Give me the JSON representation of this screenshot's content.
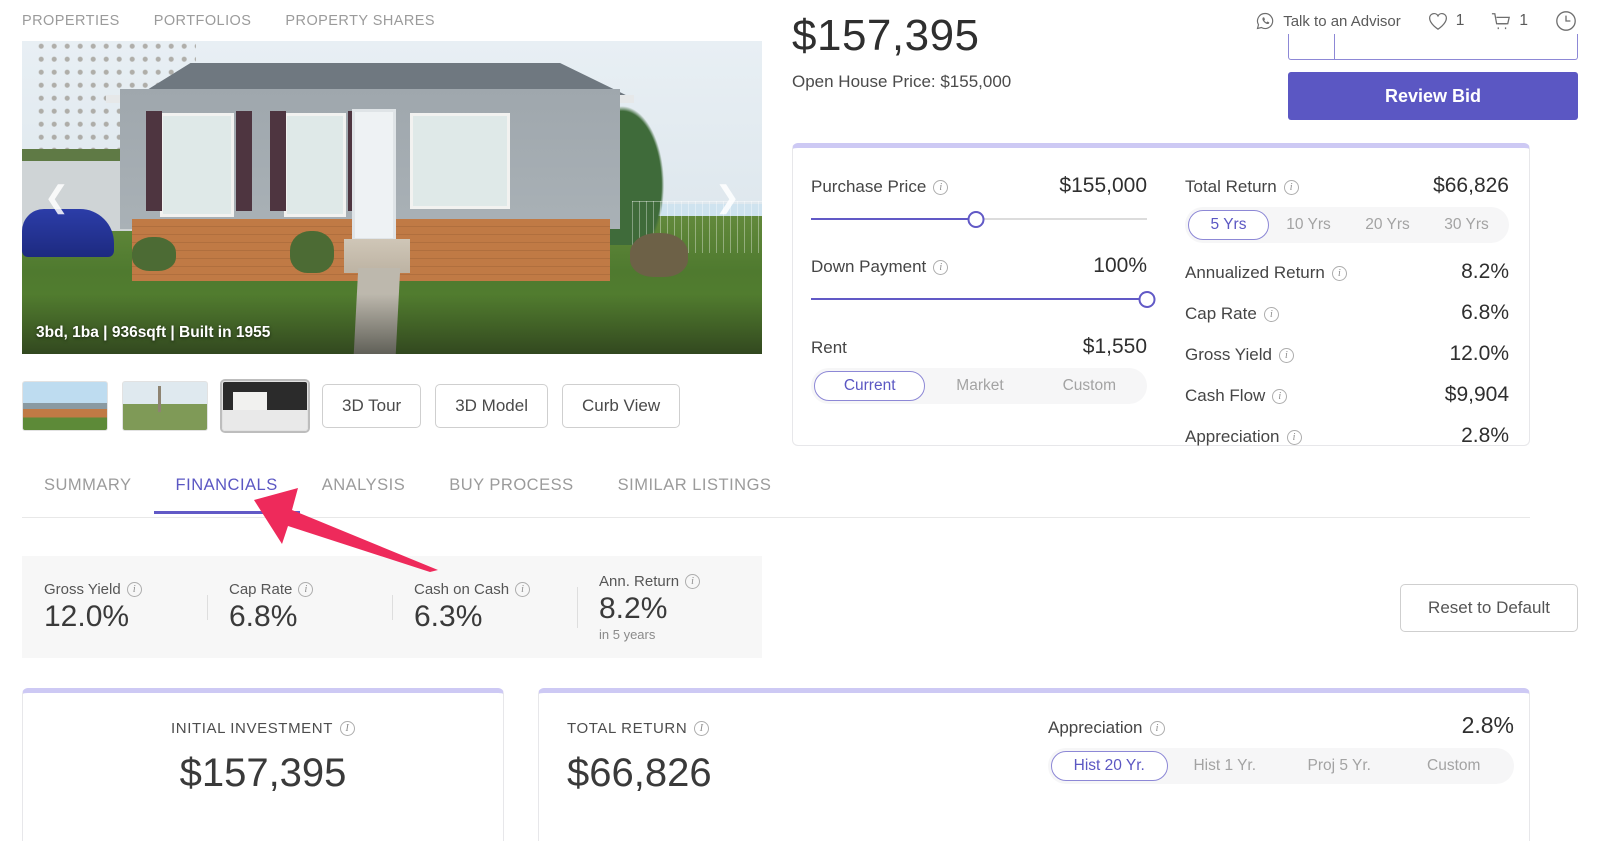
{
  "nav": {
    "links": [
      {
        "label": "PROPERTIES"
      },
      {
        "label": "PORTFOLIOS"
      },
      {
        "label": "PROPERTY SHARES"
      }
    ],
    "advisor_label": "Talk to an Advisor",
    "advisor_icon": "whatsapp-chat-icon",
    "favorites": {
      "icon": "heart-icon",
      "count": "1"
    },
    "cart": {
      "icon": "cart-icon",
      "count": "1"
    },
    "history": {
      "icon": "clock-icon"
    }
  },
  "gallery": {
    "caption": "3bd, 1ba | 936sqft | Built in 1955",
    "prev_icon": "chevron-left-icon",
    "next_icon": "chevron-right-icon",
    "thumbs": [
      {
        "name": "exterior-front"
      },
      {
        "name": "backyard"
      },
      {
        "name": "kitchen"
      }
    ],
    "buttons": [
      {
        "label": "3D Tour"
      },
      {
        "label": "3D Model"
      },
      {
        "label": "Curb View"
      }
    ]
  },
  "price": {
    "amount": "$157,395",
    "open_house": "Open House Price: $155,000"
  },
  "bid": {
    "button_label": "Review Bid"
  },
  "calculator": {
    "purchase_price": {
      "label": "Purchase Price",
      "value": "$155,000",
      "slider_percent": 49
    },
    "down_payment": {
      "label": "Down Payment",
      "value": "100%",
      "slider_percent": 100
    },
    "rent": {
      "label": "Rent",
      "value": "$1,550",
      "options": [
        "Current",
        "Market",
        "Custom"
      ],
      "selected": "Current"
    }
  },
  "returns": {
    "total_return": {
      "label": "Total Return",
      "value": "$66,826"
    },
    "horizon_options": [
      "5 Yrs",
      "10 Yrs",
      "20 Yrs",
      "30 Yrs"
    ],
    "horizon_selected": "5 Yrs",
    "metrics": [
      {
        "label": "Annualized Return",
        "value": "8.2%"
      },
      {
        "label": "Cap Rate",
        "value": "6.8%"
      },
      {
        "label": "Gross Yield",
        "value": "12.0%"
      },
      {
        "label": "Cash Flow",
        "value": "$9,904"
      },
      {
        "label": "Appreciation",
        "value": "2.8%"
      }
    ]
  },
  "tabs": {
    "items": [
      {
        "label": "SUMMARY",
        "active": false
      },
      {
        "label": "FINANCIALS",
        "active": true
      },
      {
        "label": "ANALYSIS",
        "active": false
      },
      {
        "label": "BUY PROCESS",
        "active": false
      },
      {
        "label": "SIMILAR LISTINGS",
        "active": false
      }
    ]
  },
  "kpis": [
    {
      "label": "Gross Yield",
      "value": "12.0%",
      "note": ""
    },
    {
      "label": "Cap Rate",
      "value": "6.8%",
      "note": ""
    },
    {
      "label": "Cash on Cash",
      "value": "6.3%",
      "note": ""
    },
    {
      "label": "Ann. Return",
      "value": "8.2%",
      "note": "in 5 years"
    }
  ],
  "reset_button": {
    "label": "Reset to Default"
  },
  "cards": {
    "initial_investment": {
      "title": "INITIAL INVESTMENT",
      "value": "$157,395"
    },
    "total_return": {
      "title": "TOTAL RETURN",
      "value": "$66,826"
    },
    "appreciation": {
      "label": "Appreciation",
      "value": "2.8%",
      "options": [
        "Hist 20 Yr.",
        "Hist 1 Yr.",
        "Proj 5 Yr.",
        "Custom"
      ],
      "selected": "Hist 20 Yr."
    }
  },
  "annotation": {
    "arrow_color": "#ef २a5c",
    "target": "FINANCIALS"
  },
  "colors": {
    "accent_purple": "#5b57c3",
    "accent_purple_light": "#cdc9f4",
    "annotation_pink": "#ee2a5b",
    "muted_text": "#9b9b9b"
  }
}
